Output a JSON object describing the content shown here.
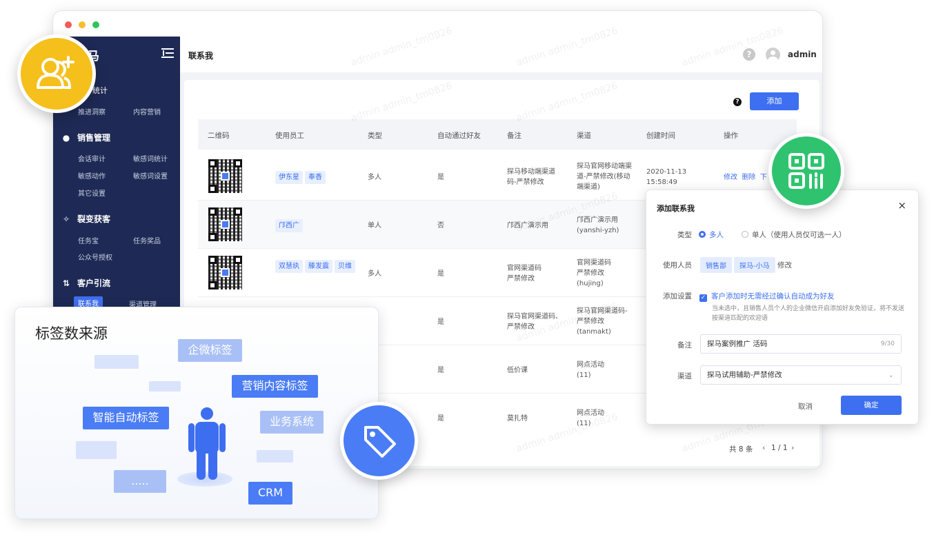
{
  "sidebar": {
    "logo_fragment": "马",
    "top_stat_label": "统计",
    "top_sub": [
      "推进洞察",
      "内容营销"
    ],
    "sections": [
      {
        "label": "销售管理",
        "icon": "person-icon",
        "items": [
          "会话审计",
          "敏感词统计",
          "敏感动作",
          "敏感词设置",
          "其它设置"
        ]
      },
      {
        "label": "裂变获客",
        "icon": "fission-icon",
        "items": [
          "任务宝",
          "任务奖品",
          "公众号授权"
        ]
      },
      {
        "label": "客户引流",
        "icon": "transfer-icon",
        "items": [
          "联系我",
          "渠道管理"
        ]
      }
    ]
  },
  "header": {
    "title": "联系我",
    "user": "admin"
  },
  "toolbar": {
    "add_label": "添加"
  },
  "table": {
    "columns": [
      "二维码",
      "使用员工",
      "类型",
      "自动通过好友",
      "备注",
      "渠道",
      "创建时间",
      "操作"
    ],
    "rows": [
      {
        "staff": [
          "伊东星",
          "奉香"
        ],
        "type": "多人",
        "auto": "是",
        "remark": "探马移动端渠道码-严禁修改",
        "channel": "探马官网移动端渠道-严禁修改(移动端渠道)",
        "created": "2020-11-13 15:58:49",
        "actions": [
          "修改",
          "删除",
          "下"
        ]
      },
      {
        "staff": [
          "邝西广"
        ],
        "type": "单人",
        "auto": "否",
        "remark": "邝西广演示用",
        "channel": "邝西广演示用 (yanshi-yzh)",
        "created": "",
        "actions": []
      },
      {
        "staff": [
          "双慧纨",
          "滕发震",
          "贝维"
        ],
        "type": "多人",
        "auto": "是",
        "remark": "官网渠道码 严禁修改",
        "channel": "官网渠道码 严禁修改 (hujing)",
        "created": "",
        "actions": []
      },
      {
        "staff": [],
        "type": "",
        "auto": "是",
        "remark": "探马官网渠道码、严禁修改",
        "channel": "探马官网渠道码-严禁修改 (tanmakt)",
        "created": "",
        "actions": []
      },
      {
        "staff": [],
        "type": "",
        "auto": "是",
        "remark": "低价课",
        "channel": "网点活动 (11)",
        "created": "",
        "actions": []
      },
      {
        "staff": [],
        "type": "",
        "auto": "是",
        "remark": "莫扎特",
        "channel": "网点活动 (11)",
        "created": "",
        "actions": []
      }
    ],
    "pagination": {
      "total": "共 8 条",
      "pages": "1 / 1"
    }
  },
  "dialog": {
    "title": "添加联系我",
    "type_label": "类型",
    "type_options": [
      "多人",
      "单人（使用人员仅可选一人）"
    ],
    "staff_label": "使用人员",
    "staff_tags": [
      "销售部",
      "探马-小马"
    ],
    "staff_edit": "修改",
    "setting_label": "添加设置",
    "setting_check": "客户添加时无需经过确认自动成为好友",
    "setting_hint": "当未选中，且销售人员个人的企业微信开启添加好友免验证，将不发送按渠道匹配的欢迎语",
    "remark_label": "备注",
    "remark_value": "探马案例推广 活码",
    "remark_count": "9/30",
    "channel_label": "渠道",
    "channel_value": "探马试用辅助-严禁修改",
    "cancel": "取消",
    "confirm": "确定"
  },
  "tag_card": {
    "title": "标签数来源",
    "tags": [
      "企微标签",
      "营销内容标签",
      "智能自动标签",
      "业务系统",
      "CRM",
      "....."
    ]
  },
  "watermark": "admin admin_tm0826",
  "colors": {
    "primary": "#3d6ff0",
    "sidebar": "#1e2a55",
    "badge_yellow": "#f5bf1c",
    "badge_green": "#2fc36f"
  }
}
